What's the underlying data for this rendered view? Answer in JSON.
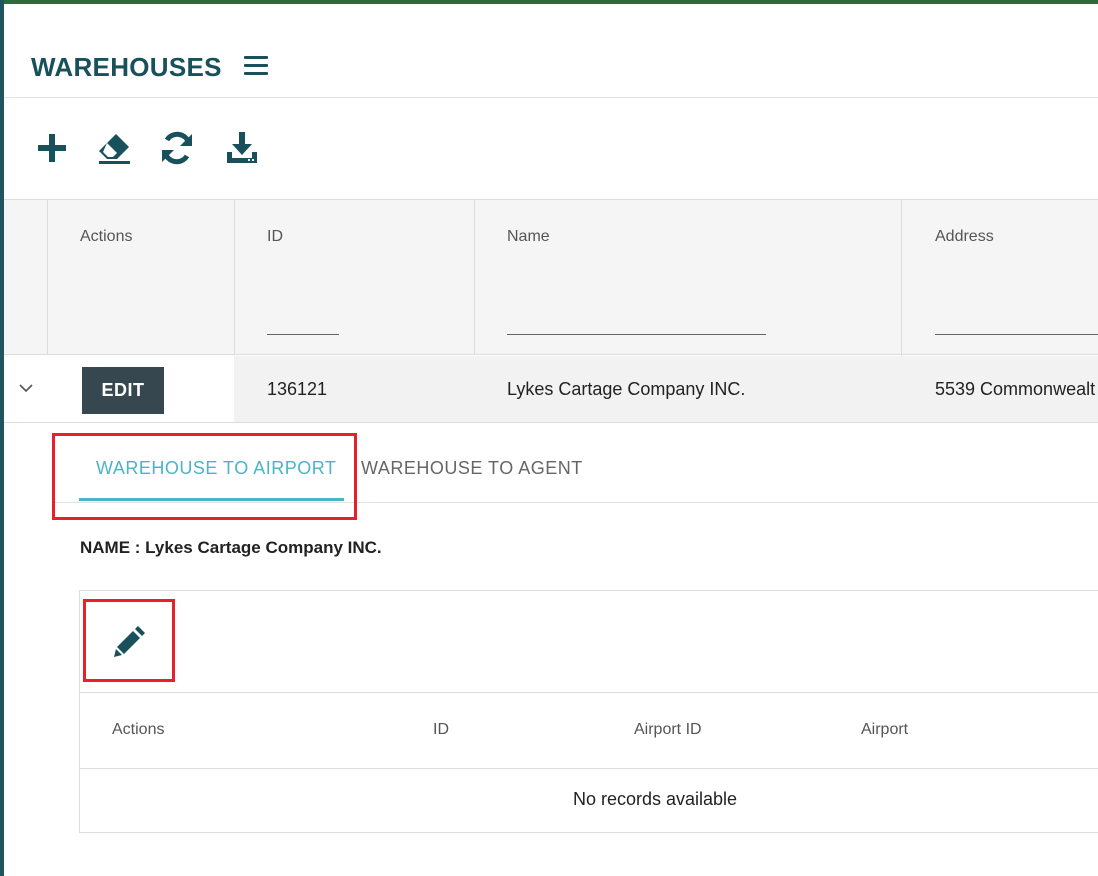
{
  "page": {
    "title": "WAREHOUSES"
  },
  "toolbar": {
    "icons": [
      "plus-icon",
      "eraser-icon",
      "refresh-icon",
      "download-icon"
    ]
  },
  "grid": {
    "columns": [
      "Actions",
      "ID",
      "Name",
      "Address"
    ],
    "rows": [
      {
        "edit_label": "EDIT",
        "id": "136121",
        "name": "Lykes Cartage Company INC.",
        "address": "5539 Commonwealt"
      }
    ]
  },
  "detail": {
    "tabs": [
      {
        "label": "WAREHOUSE TO AIRPORT",
        "active": true
      },
      {
        "label": "WAREHOUSE TO AGENT",
        "active": false
      }
    ],
    "name_line": "NAME : Lykes Cartage Company INC.",
    "sub_grid": {
      "columns": [
        "Actions",
        "ID",
        "Airport ID",
        "Airport"
      ],
      "empty_text": "No records available"
    }
  },
  "colors": {
    "brand_dark": "#18505c",
    "tab_active": "#4ab4c8",
    "highlight": "#e8202a",
    "edit_button": "#37474f"
  }
}
